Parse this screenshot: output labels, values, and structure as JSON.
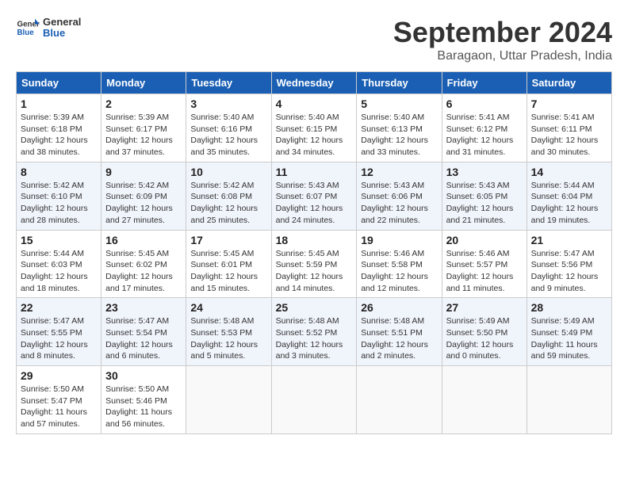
{
  "header": {
    "logo_text_general": "General",
    "logo_text_blue": "Blue",
    "month_title": "September 2024",
    "location": "Baragaon, Uttar Pradesh, India"
  },
  "calendar": {
    "days_of_week": [
      "Sunday",
      "Monday",
      "Tuesday",
      "Wednesday",
      "Thursday",
      "Friday",
      "Saturday"
    ],
    "weeks": [
      [
        {
          "day": "1",
          "info": "Sunrise: 5:39 AM\nSunset: 6:18 PM\nDaylight: 12 hours and 38 minutes."
        },
        {
          "day": "2",
          "info": "Sunrise: 5:39 AM\nSunset: 6:17 PM\nDaylight: 12 hours and 37 minutes."
        },
        {
          "day": "3",
          "info": "Sunrise: 5:40 AM\nSunset: 6:16 PM\nDaylight: 12 hours and 35 minutes."
        },
        {
          "day": "4",
          "info": "Sunrise: 5:40 AM\nSunset: 6:15 PM\nDaylight: 12 hours and 34 minutes."
        },
        {
          "day": "5",
          "info": "Sunrise: 5:40 AM\nSunset: 6:13 PM\nDaylight: 12 hours and 33 minutes."
        },
        {
          "day": "6",
          "info": "Sunrise: 5:41 AM\nSunset: 6:12 PM\nDaylight: 12 hours and 31 minutes."
        },
        {
          "day": "7",
          "info": "Sunrise: 5:41 AM\nSunset: 6:11 PM\nDaylight: 12 hours and 30 minutes."
        }
      ],
      [
        {
          "day": "8",
          "info": "Sunrise: 5:42 AM\nSunset: 6:10 PM\nDaylight: 12 hours and 28 minutes."
        },
        {
          "day": "9",
          "info": "Sunrise: 5:42 AM\nSunset: 6:09 PM\nDaylight: 12 hours and 27 minutes."
        },
        {
          "day": "10",
          "info": "Sunrise: 5:42 AM\nSunset: 6:08 PM\nDaylight: 12 hours and 25 minutes."
        },
        {
          "day": "11",
          "info": "Sunrise: 5:43 AM\nSunset: 6:07 PM\nDaylight: 12 hours and 24 minutes."
        },
        {
          "day": "12",
          "info": "Sunrise: 5:43 AM\nSunset: 6:06 PM\nDaylight: 12 hours and 22 minutes."
        },
        {
          "day": "13",
          "info": "Sunrise: 5:43 AM\nSunset: 6:05 PM\nDaylight: 12 hours and 21 minutes."
        },
        {
          "day": "14",
          "info": "Sunrise: 5:44 AM\nSunset: 6:04 PM\nDaylight: 12 hours and 19 minutes."
        }
      ],
      [
        {
          "day": "15",
          "info": "Sunrise: 5:44 AM\nSunset: 6:03 PM\nDaylight: 12 hours and 18 minutes."
        },
        {
          "day": "16",
          "info": "Sunrise: 5:45 AM\nSunset: 6:02 PM\nDaylight: 12 hours and 17 minutes."
        },
        {
          "day": "17",
          "info": "Sunrise: 5:45 AM\nSunset: 6:01 PM\nDaylight: 12 hours and 15 minutes."
        },
        {
          "day": "18",
          "info": "Sunrise: 5:45 AM\nSunset: 5:59 PM\nDaylight: 12 hours and 14 minutes."
        },
        {
          "day": "19",
          "info": "Sunrise: 5:46 AM\nSunset: 5:58 PM\nDaylight: 12 hours and 12 minutes."
        },
        {
          "day": "20",
          "info": "Sunrise: 5:46 AM\nSunset: 5:57 PM\nDaylight: 12 hours and 11 minutes."
        },
        {
          "day": "21",
          "info": "Sunrise: 5:47 AM\nSunset: 5:56 PM\nDaylight: 12 hours and 9 minutes."
        }
      ],
      [
        {
          "day": "22",
          "info": "Sunrise: 5:47 AM\nSunset: 5:55 PM\nDaylight: 12 hours and 8 minutes."
        },
        {
          "day": "23",
          "info": "Sunrise: 5:47 AM\nSunset: 5:54 PM\nDaylight: 12 hours and 6 minutes."
        },
        {
          "day": "24",
          "info": "Sunrise: 5:48 AM\nSunset: 5:53 PM\nDaylight: 12 hours and 5 minutes."
        },
        {
          "day": "25",
          "info": "Sunrise: 5:48 AM\nSunset: 5:52 PM\nDaylight: 12 hours and 3 minutes."
        },
        {
          "day": "26",
          "info": "Sunrise: 5:48 AM\nSunset: 5:51 PM\nDaylight: 12 hours and 2 minutes."
        },
        {
          "day": "27",
          "info": "Sunrise: 5:49 AM\nSunset: 5:50 PM\nDaylight: 12 hours and 0 minutes."
        },
        {
          "day": "28",
          "info": "Sunrise: 5:49 AM\nSunset: 5:49 PM\nDaylight: 11 hours and 59 minutes."
        }
      ],
      [
        {
          "day": "29",
          "info": "Sunrise: 5:50 AM\nSunset: 5:47 PM\nDaylight: 11 hours and 57 minutes."
        },
        {
          "day": "30",
          "info": "Sunrise: 5:50 AM\nSunset: 5:46 PM\nDaylight: 11 hours and 56 minutes."
        },
        {
          "day": "",
          "info": ""
        },
        {
          "day": "",
          "info": ""
        },
        {
          "day": "",
          "info": ""
        },
        {
          "day": "",
          "info": ""
        },
        {
          "day": "",
          "info": ""
        }
      ]
    ]
  }
}
